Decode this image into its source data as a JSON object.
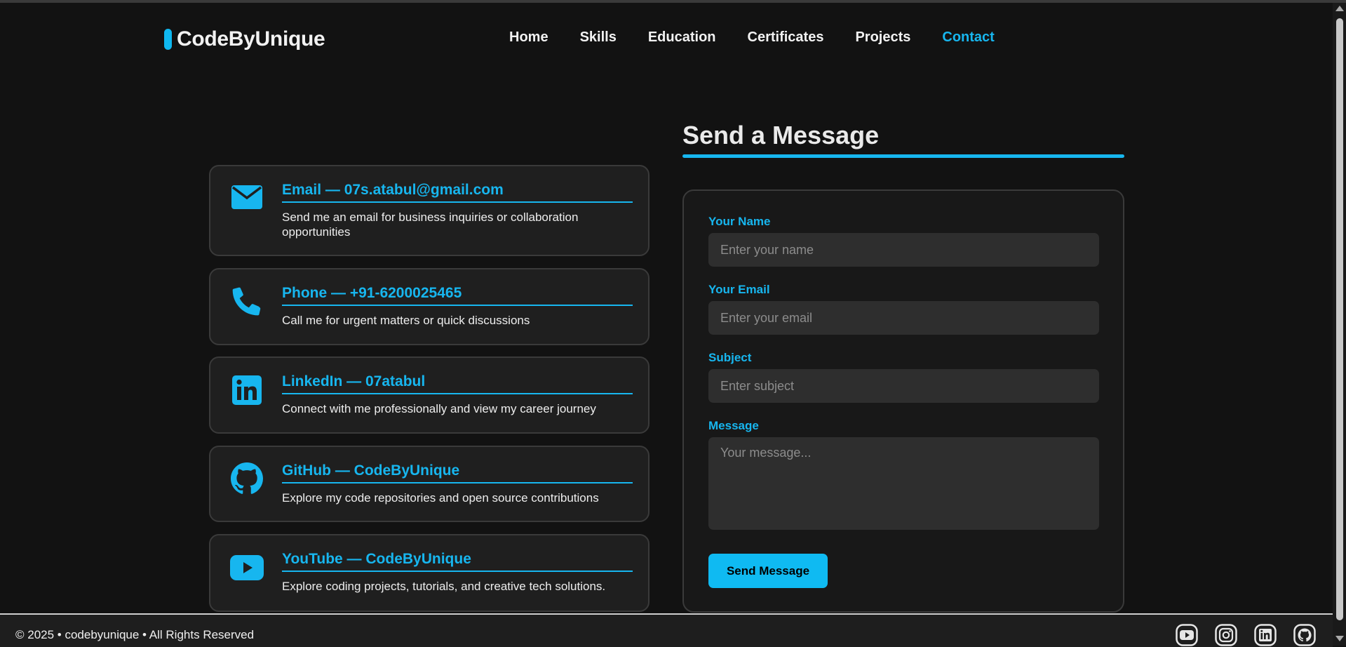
{
  "brand": {
    "name": "CodeByUnique",
    "accent": "#17b6ef"
  },
  "nav": {
    "items": [
      {
        "label": "Home"
      },
      {
        "label": "Skills"
      },
      {
        "label": "Education"
      },
      {
        "label": "Certificates"
      },
      {
        "label": "Projects"
      },
      {
        "label": "Contact",
        "active": true
      }
    ]
  },
  "contact_cards": [
    {
      "icon": "envelope-icon",
      "title": "Email — 07s.atabul@gmail.com",
      "description": "Send me an email for business inquiries or collaboration opportunities"
    },
    {
      "icon": "phone-icon",
      "title": "Phone — +91-6200025465",
      "description": "Call me for urgent matters or quick discussions"
    },
    {
      "icon": "linkedin-icon",
      "title": "LinkedIn — 07atabul",
      "description": "Connect with me professionally and view my career journey"
    },
    {
      "icon": "github-icon",
      "title": "GitHub — CodeByUnique",
      "description": "Explore my code repositories and open source contributions"
    },
    {
      "icon": "youtube-icon",
      "title": "YouTube — CodeByUnique",
      "description": "Explore coding projects, tutorials, and creative tech solutions."
    }
  ],
  "form": {
    "heading": "Send a Message",
    "name_label": "Your Name",
    "name_placeholder": "Enter your name",
    "email_label": "Your Email",
    "email_placeholder": "Enter your email",
    "subject_label": "Subject",
    "subject_placeholder": "Enter subject",
    "message_label": "Message",
    "message_placeholder": "Your message...",
    "submit_label": "Send Message"
  },
  "footer": {
    "copyright": "© 2025 • codebyunique • All Rights Reserved",
    "social_icons": [
      "youtube-icon",
      "instagram-icon",
      "linkedin-icon",
      "github-icon"
    ]
  }
}
